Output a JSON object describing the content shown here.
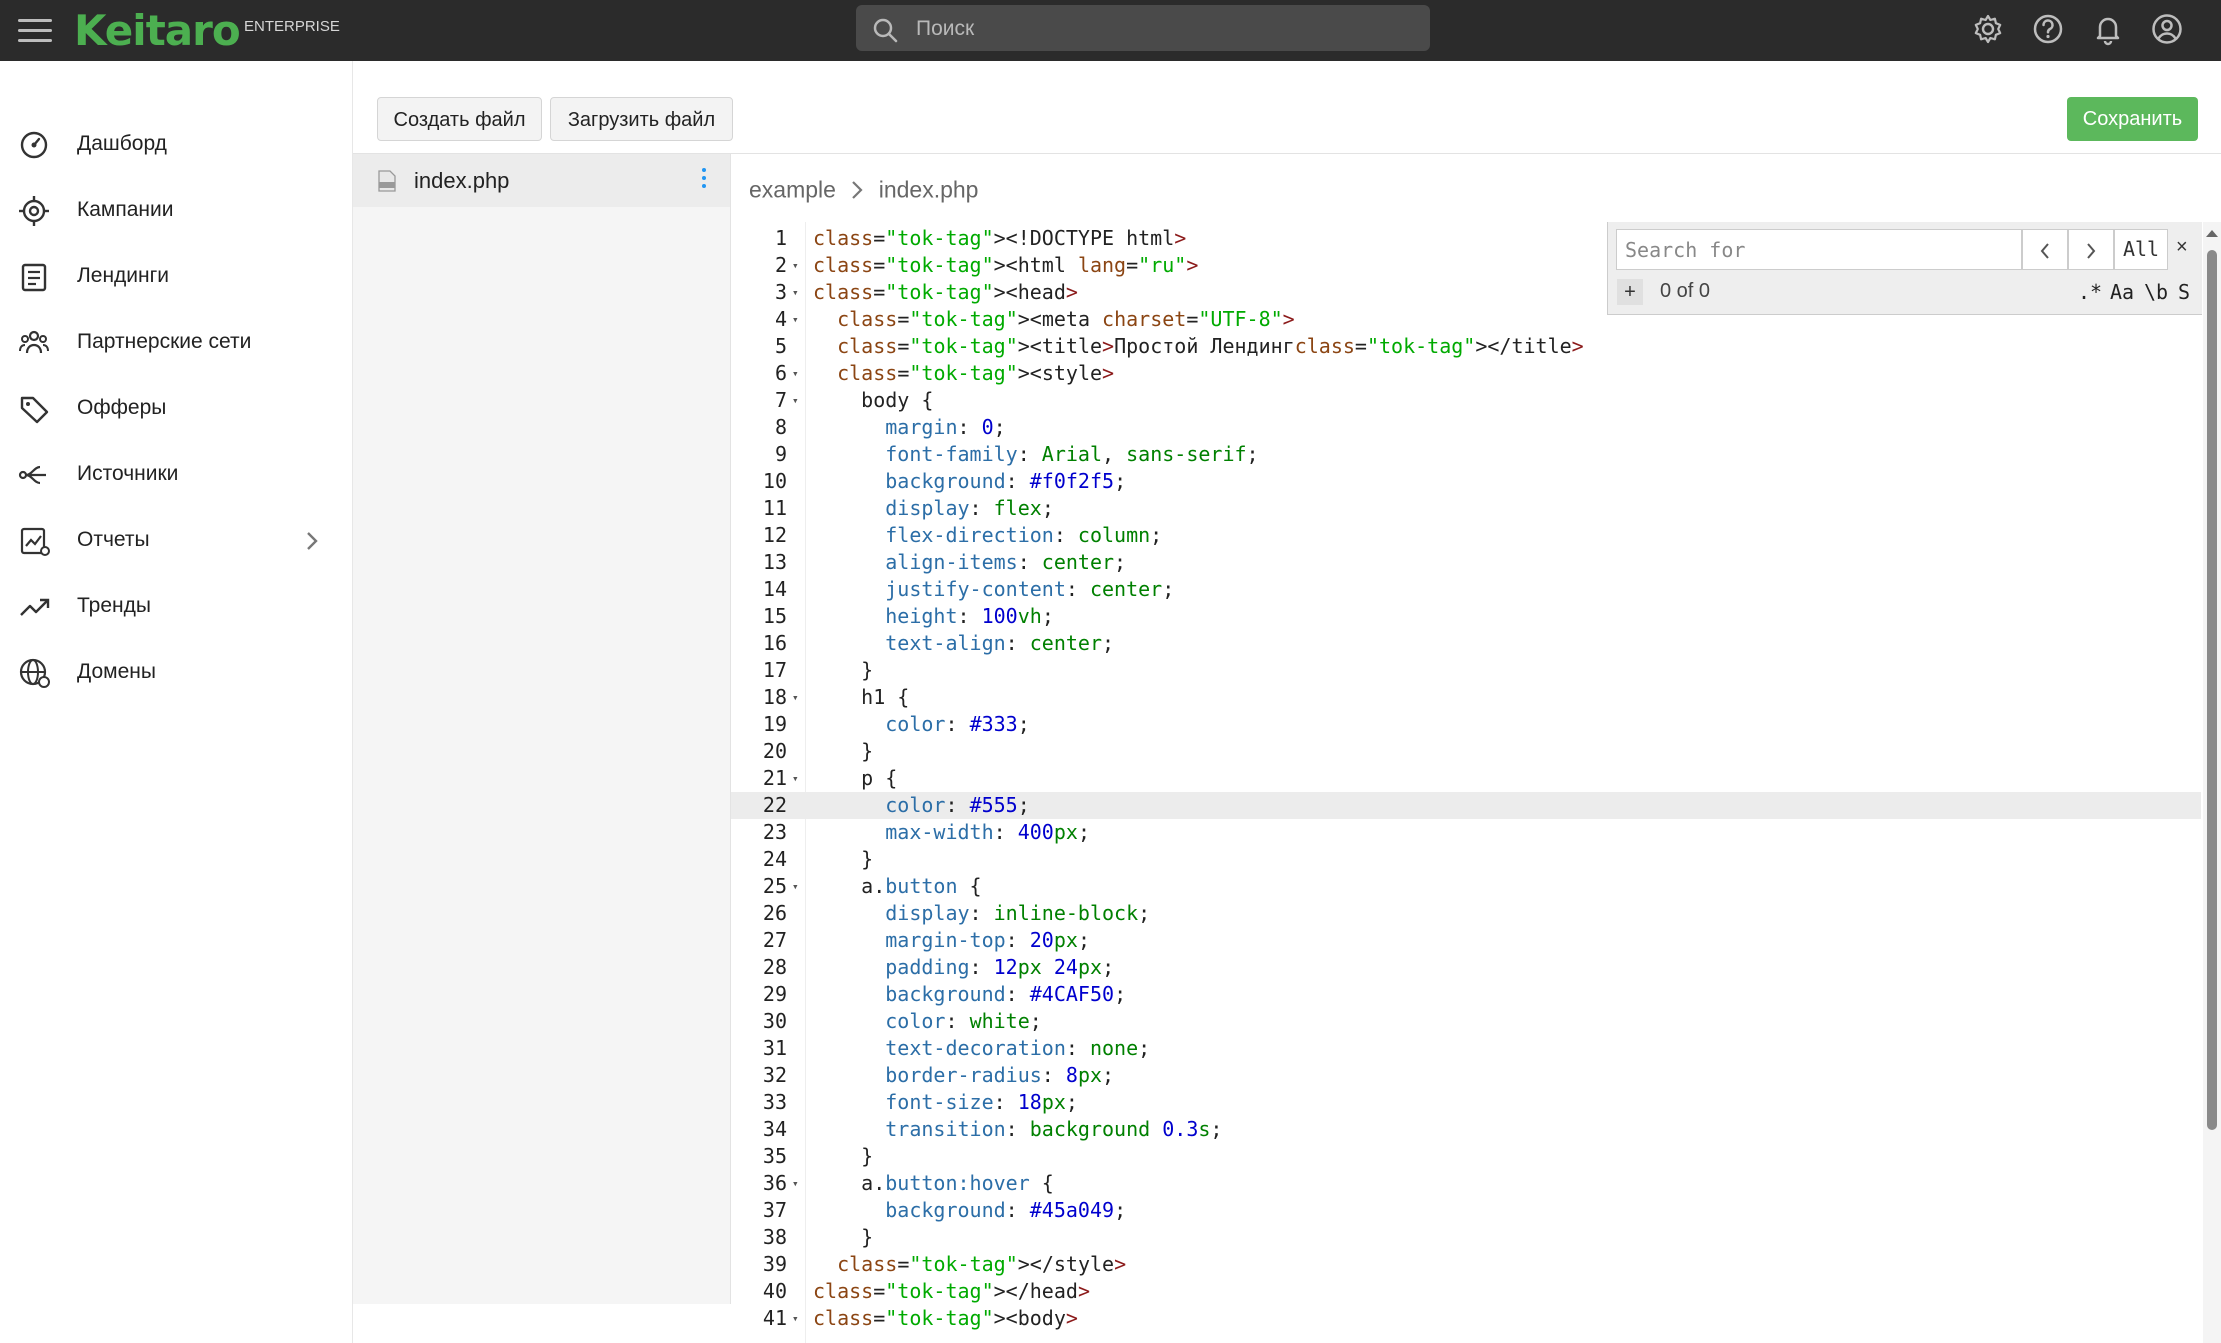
{
  "header": {
    "logo": "Keitaro",
    "edition": "ENTERPRISE",
    "search_placeholder": "Поиск",
    "icons": [
      "menu-icon",
      "settings-icon",
      "help-icon",
      "bell-icon",
      "account-icon"
    ]
  },
  "sidebar": {
    "items": [
      {
        "label": "Дашборд",
        "icon": "dashboard-icon"
      },
      {
        "label": "Кампании",
        "icon": "target-icon"
      },
      {
        "label": "Лендинги",
        "icon": "document-icon"
      },
      {
        "label": "Партнерские сети",
        "icon": "people-icon"
      },
      {
        "label": "Офферы",
        "icon": "tag-icon"
      },
      {
        "label": "Источники",
        "icon": "source-icon"
      },
      {
        "label": "Отчеты",
        "icon": "report-icon"
      },
      {
        "label": "Тренды",
        "icon": "trending-icon"
      },
      {
        "label": "Домены",
        "icon": "globe-icon"
      }
    ]
  },
  "toolbar": {
    "create_label": "Создать файл",
    "upload_label": "Загрузить файл",
    "save_label": "Сохранить"
  },
  "files": {
    "items": [
      {
        "name": "index.php"
      }
    ]
  },
  "breadcrumb": {
    "folder": "example",
    "file": "index.php"
  },
  "search_box": {
    "placeholder": "Search for",
    "all_label": "All",
    "close_label": "×",
    "plus_label": "+",
    "count": "0 of 0",
    "opt_regex": ".*",
    "opt_case": "Aa",
    "opt_word": "\\b",
    "opt_s": "S"
  },
  "editor": {
    "active_line": 22,
    "lines": [
      {
        "n": "1",
        "t": "<!DOCTYPE html>"
      },
      {
        "n": "2",
        "t": "<html lang=\"ru\">"
      },
      {
        "n": "3",
        "t": "<head>"
      },
      {
        "n": "4",
        "t": "  <meta charset=\"UTF-8\">"
      },
      {
        "n": "5",
        "t": "  <title>Простой Лендинг</title>"
      },
      {
        "n": "6",
        "t": "  <style>"
      },
      {
        "n": "7",
        "t": "    body {"
      },
      {
        "n": "8",
        "t": "      margin: 0;"
      },
      {
        "n": "9",
        "t": "      font-family: Arial, sans-serif;"
      },
      {
        "n": "10",
        "t": "      background: #f0f2f5;"
      },
      {
        "n": "11",
        "t": "      display: flex;"
      },
      {
        "n": "12",
        "t": "      flex-direction: column;"
      },
      {
        "n": "13",
        "t": "      align-items: center;"
      },
      {
        "n": "14",
        "t": "      justify-content: center;"
      },
      {
        "n": "15",
        "t": "      height: 100vh;"
      },
      {
        "n": "16",
        "t": "      text-align: center;"
      },
      {
        "n": "17",
        "t": "    }"
      },
      {
        "n": "18",
        "t": "    h1 {"
      },
      {
        "n": "19",
        "t": "      color: #333;"
      },
      {
        "n": "20",
        "t": "    }"
      },
      {
        "n": "21",
        "t": "    p {"
      },
      {
        "n": "22",
        "t": "      color: #555;"
      },
      {
        "n": "23",
        "t": "      max-width: 400px;"
      },
      {
        "n": "24",
        "t": "    }"
      },
      {
        "n": "25",
        "t": "    a.button {"
      },
      {
        "n": "26",
        "t": "      display: inline-block;"
      },
      {
        "n": "27",
        "t": "      margin-top: 20px;"
      },
      {
        "n": "28",
        "t": "      padding: 12px 24px;"
      },
      {
        "n": "29",
        "t": "      background: #4CAF50;"
      },
      {
        "n": "30",
        "t": "      color: white;"
      },
      {
        "n": "31",
        "t": "      text-decoration: none;"
      },
      {
        "n": "32",
        "t": "      border-radius: 8px;"
      },
      {
        "n": "33",
        "t": "      font-size: 18px;"
      },
      {
        "n": "34",
        "t": "      transition: background 0.3s;"
      },
      {
        "n": "35",
        "t": "    }"
      },
      {
        "n": "36",
        "t": "    a.button:hover {"
      },
      {
        "n": "37",
        "t": "      background: #45a049;"
      },
      {
        "n": "38",
        "t": "    }"
      },
      {
        "n": "39",
        "t": "  </style>"
      },
      {
        "n": "40",
        "t": "</head>"
      },
      {
        "n": "41",
        "t": "<body>"
      }
    ],
    "fold_lines": [
      2,
      3,
      4,
      6,
      7,
      18,
      21,
      25,
      36,
      41
    ]
  },
  "colors": {
    "brand": "#4caf50",
    "topbar": "#2b2b2b",
    "save": "#5cb85c",
    "kebab": "#2196f3"
  }
}
